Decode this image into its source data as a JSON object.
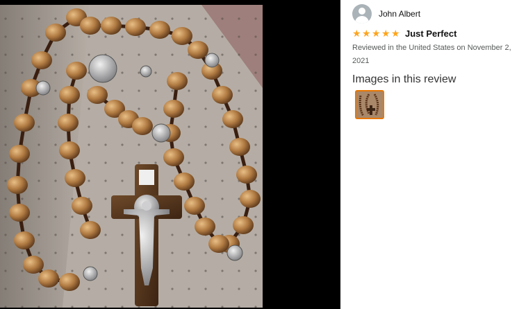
{
  "review": {
    "reviewer_name": "John Albert",
    "rating": 5,
    "rating_max": 5,
    "title": "Just Perfect",
    "date_line": "Reviewed in the United States on November 2, 2021",
    "images_heading": "Images in this review"
  },
  "icons": {
    "avatar": "default-user-avatar-icon",
    "star": "star-icon"
  },
  "colors": {
    "star": "#ffa41c",
    "thumb_border": "#e77600",
    "viewer_bg": "#000000"
  }
}
